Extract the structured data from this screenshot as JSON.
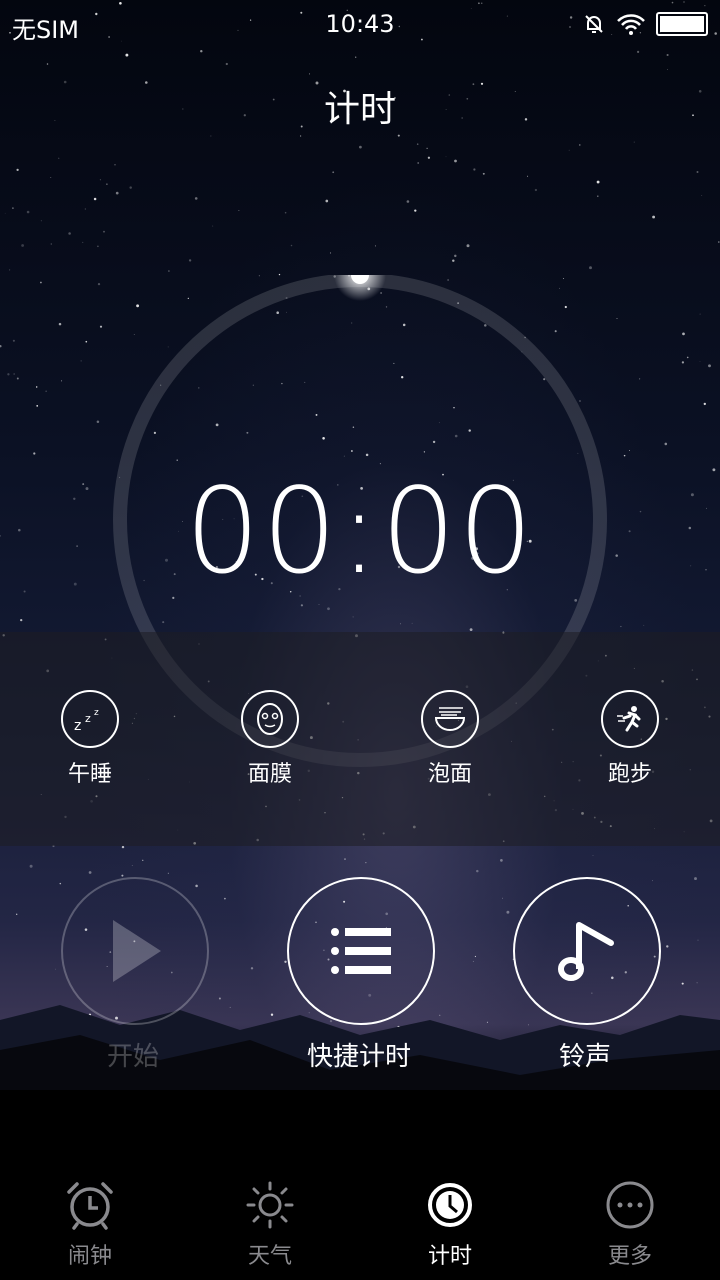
{
  "status": {
    "carrier": "无SIM",
    "time": "10:43"
  },
  "title": "计时",
  "timer": {
    "display": "00:00",
    "progress": 0
  },
  "quick_timers": [
    {
      "label": "午睡",
      "icon": "sleep-zzz-icon"
    },
    {
      "label": "面膜",
      "icon": "face-mask-icon"
    },
    {
      "label": "泡面",
      "icon": "noodle-bowl-icon"
    },
    {
      "label": "跑步",
      "icon": "running-icon"
    }
  ],
  "actions": {
    "start": {
      "label": "开始",
      "enabled": false
    },
    "quick_timer": {
      "label": "快捷计时"
    },
    "ringtone": {
      "label": "铃声"
    }
  },
  "tabs": [
    {
      "label": "闹钟",
      "icon": "alarm-clock-icon",
      "active": false
    },
    {
      "label": "天气",
      "icon": "sun-icon",
      "active": false
    },
    {
      "label": "计时",
      "icon": "timer-icon",
      "active": true
    },
    {
      "label": "更多",
      "icon": "more-dots-icon",
      "active": false
    }
  ]
}
